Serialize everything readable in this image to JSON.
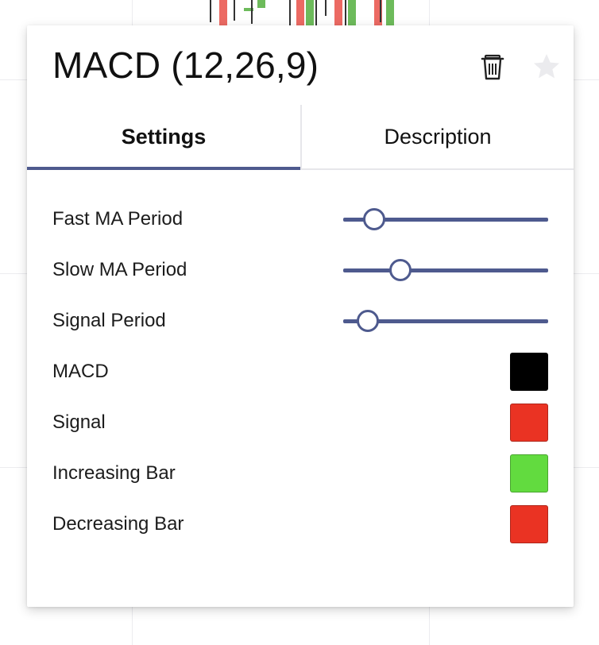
{
  "panel": {
    "title": "MACD (12,26,9)",
    "icons": {
      "delete": "trash-icon",
      "favorite": "star-icon"
    }
  },
  "tabs": [
    {
      "label": "Settings",
      "active": true
    },
    {
      "label": "Description",
      "active": false
    }
  ],
  "settings": {
    "sliders": [
      {
        "label": "Fast MA Period",
        "level_percent": 15
      },
      {
        "label": "Slow MA Period",
        "level_percent": 28
      },
      {
        "label": "Signal Period",
        "level_percent": 12
      }
    ],
    "colors": [
      {
        "label": "MACD",
        "color": "#000000"
      },
      {
        "label": "Signal",
        "color": "#ea3323"
      },
      {
        "label": "Increasing Bar",
        "color": "#62db3f"
      },
      {
        "label": "Decreasing Bar",
        "color": "#ea3323"
      }
    ]
  },
  "theme": {
    "accent": "#4e5a8e",
    "background_candles_up": "#6dbb5b",
    "background_candles_down": "#ec6a63"
  }
}
